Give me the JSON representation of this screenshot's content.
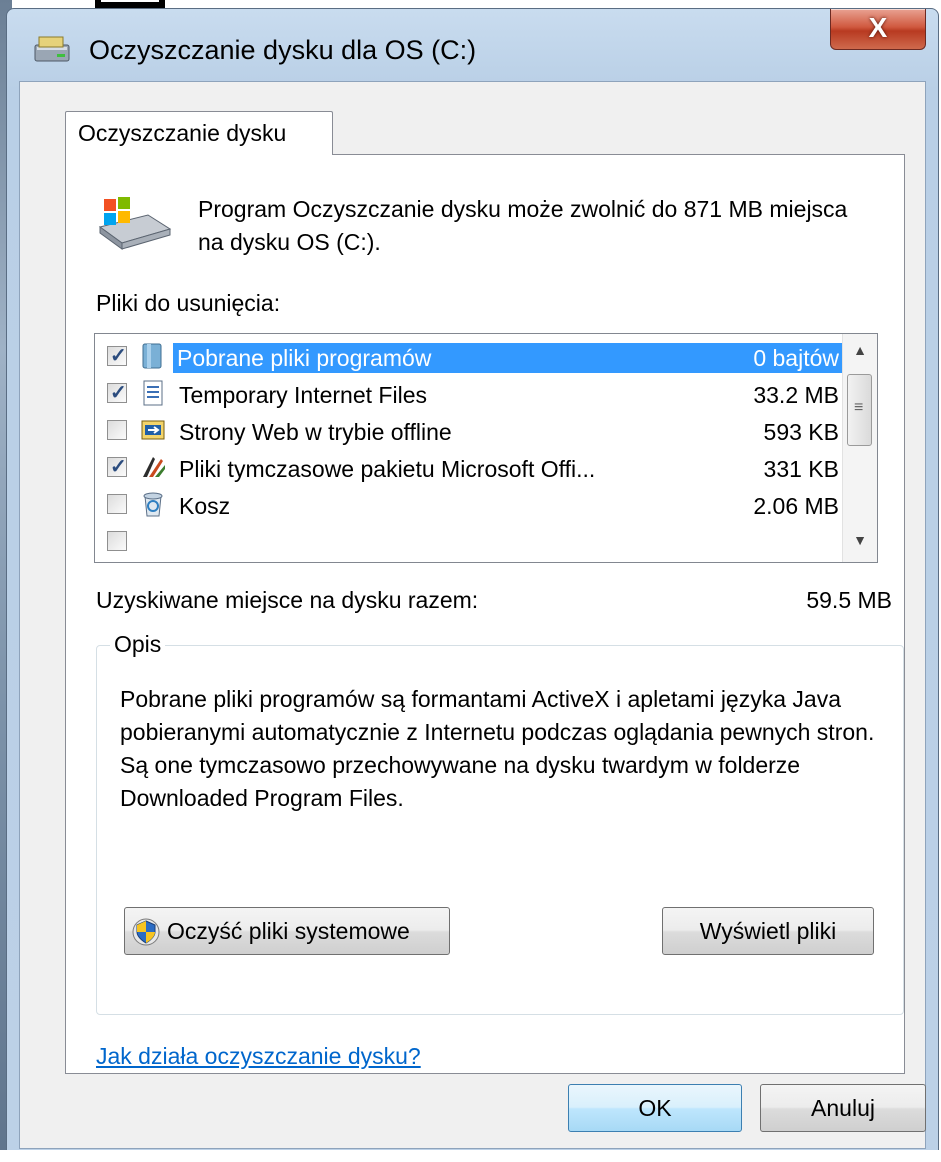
{
  "window": {
    "title": "Oczyszczanie dysku dla OS (C:)",
    "close_label": "X"
  },
  "tab": {
    "label": "Oczyszczanie dysku"
  },
  "intro": {
    "text": "Program Oczyszczanie dysku może zwolnić do 871 MB miejsca na dysku OS (C:)."
  },
  "files": {
    "label": "Pliki do usunięcia:",
    "items": [
      {
        "name": "Pobrane pliki programów",
        "size": "0 bajtów",
        "checked": true,
        "selected": true,
        "icon": "folder-icon"
      },
      {
        "name": "Temporary Internet Files",
        "size": "33.2 MB",
        "checked": true,
        "selected": false,
        "icon": "document-icon"
      },
      {
        "name": "Strony Web w trybie offline",
        "size": "593 KB",
        "checked": false,
        "selected": false,
        "icon": "offline-web-icon"
      },
      {
        "name": "Pliki tymczasowe pakietu Microsoft Offi...",
        "size": "331 KB",
        "checked": true,
        "selected": false,
        "icon": "office-icon"
      },
      {
        "name": "Kosz",
        "size": "2.06 MB",
        "checked": false,
        "selected": false,
        "icon": "recycle-bin-icon"
      }
    ]
  },
  "total": {
    "label": "Uzyskiwane miejsce na dysku razem:",
    "value": "59.5 MB"
  },
  "description": {
    "title": "Opis",
    "text": "Pobrane pliki programów są formantami ActiveX i apletami języka Java pobieranymi automatycznie z Internetu podczas oglądania pewnych stron. Są one tymczasowo przechowywane na dysku twardym w folderze Downloaded Program Files."
  },
  "buttons": {
    "clean_system": "Oczyść pliki systemowe",
    "view_files": "Wyświetl pliki",
    "ok": "OK",
    "cancel": "Anuluj"
  },
  "help_link": "Jak działa oczyszczanie dysku?"
}
